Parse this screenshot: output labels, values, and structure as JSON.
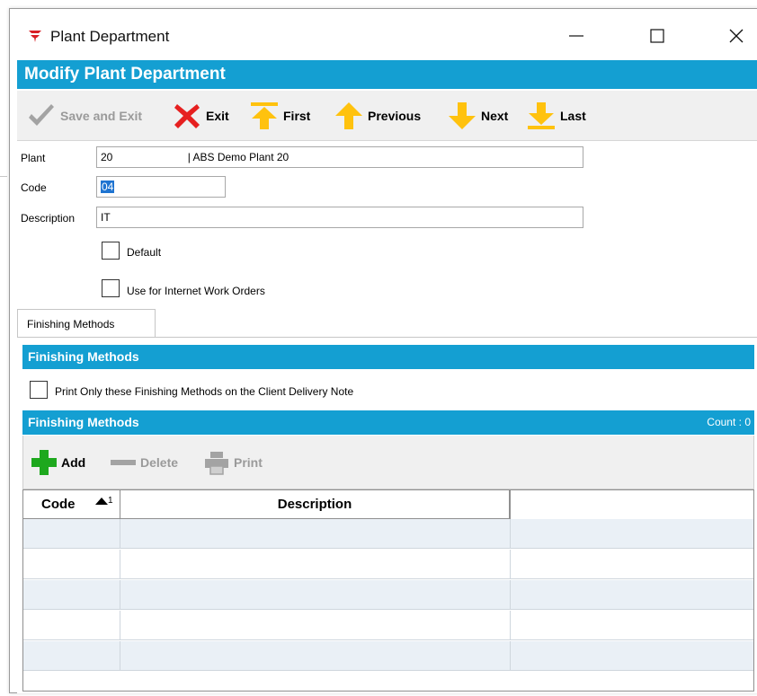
{
  "window": {
    "title": "Plant Department"
  },
  "form": {
    "title": "Modify Plant Department"
  },
  "toolbar": {
    "save_and_exit": "Save and Exit",
    "exit": "Exit",
    "first": "First",
    "previous": "Previous",
    "next": "Next",
    "last": "Last"
  },
  "fields": {
    "plant_label": "Plant",
    "plant_value": "20                         | ABS Demo Plant 20",
    "code_label": "Code",
    "code_value": "04",
    "description_label": "Description",
    "description_value": "IT",
    "default_label": "Default",
    "default_checked": false,
    "internet_label": "Use for Internet Work Orders",
    "internet_checked": false
  },
  "tabs": [
    {
      "label": "Finishing Methods",
      "active": true
    }
  ],
  "finishing": {
    "section_title": "Finishing Methods",
    "print_only_label": "Print Only these Finishing Methods on the Client Delivery Note",
    "print_only_checked": false,
    "grid_title": "Finishing Methods",
    "count_text": "Count : 0",
    "add_label": "Add",
    "delete_label": "Delete",
    "print_label": "Print",
    "columns": {
      "code": "Code",
      "description": "Description"
    },
    "sort_indicator": "1"
  },
  "colors": {
    "accent": "#149fd2",
    "arrow_yellow": "#ffc20e",
    "exit_red": "#e62020",
    "add_green": "#1ea81e",
    "disabled": "#9a9a9a"
  }
}
